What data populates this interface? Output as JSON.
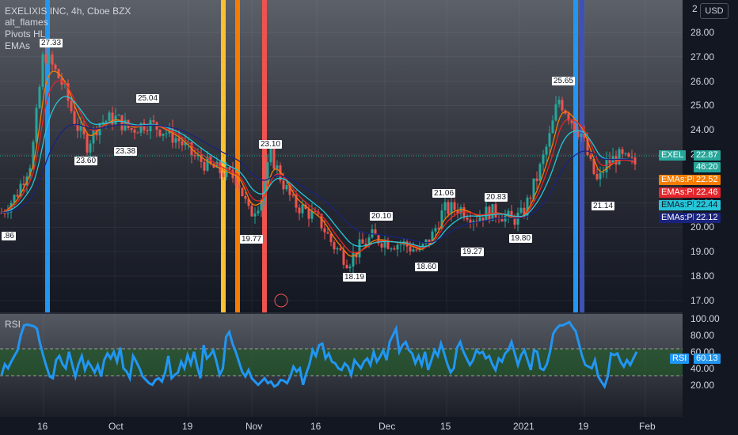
{
  "header": {
    "title": "EXELIXIS INC, 4h, Cboe BZX",
    "indicators": [
      "alt_flames",
      "Pivots HL",
      "EMAs"
    ],
    "currency_button": "USD"
  },
  "price_axis": [
    "28.00",
    "27.00",
    "26.00",
    "25.00",
    "24.00",
    "23.00",
    "22.00",
    "21.00",
    "20.00",
    "19.00",
    "18.00",
    "17.00"
  ],
  "price_axis_top_partial": "2",
  "price_tags": {
    "symbol": "EXEL",
    "last_price": "22.87",
    "countdown": "46:20",
    "ema_label": "EMAs:Plot",
    "ema_values": [
      "22.52",
      "22.46",
      "22.44",
      "22.12"
    ]
  },
  "colors": {
    "background": "#131722",
    "up": "#26a69a",
    "down": "#ef5350",
    "ema_orange": "#f57c00",
    "ema_red": "#e3262b",
    "ema_cyan": "#26c6da",
    "ema_navy": "#1a237e",
    "rsi_line": "#2196f3",
    "rsi_band": "#1b5e20"
  },
  "pivots": [
    {
      "label": "27.33",
      "hi": true
    },
    {
      "label": "25.04",
      "hi": true
    },
    {
      "label": "23.10",
      "hi": true
    },
    {
      "label": "23.60",
      "hi": false
    },
    {
      "label": "23.38",
      "hi": false
    },
    {
      "label": "19.77",
      "hi": false
    },
    {
      "label": "20.10",
      "hi": true
    },
    {
      "label": "21.06",
      "hi": true
    },
    {
      "label": "20.83",
      "hi": true
    },
    {
      "label": "25.65",
      "hi": true
    },
    {
      "label": "18.19",
      "hi": false
    },
    {
      "label": "18.60",
      "hi": false
    },
    {
      "label": "19.27",
      "hi": false
    },
    {
      "label": "19.80",
      "hi": false
    },
    {
      "label": "21.14",
      "hi": false
    },
    {
      "label": ".86",
      "hi": false
    }
  ],
  "rsi": {
    "title": "RSI",
    "axis": [
      "100.00",
      "80.00",
      "60.00",
      "40.00",
      "20.00"
    ],
    "label": "RSI",
    "value": "60.13",
    "values": [
      32,
      45,
      40,
      48,
      55,
      62,
      80,
      92,
      93,
      92,
      91,
      88,
      70,
      55,
      42,
      30,
      28,
      50,
      55,
      45,
      40,
      60,
      45,
      30,
      45,
      55,
      38,
      48,
      42,
      35,
      44,
      30,
      50,
      58,
      52,
      60,
      48,
      65,
      40,
      36,
      28,
      55,
      48,
      40,
      30,
      26,
      22,
      20,
      26,
      28,
      24,
      35,
      55,
      28,
      32,
      35,
      48,
      40,
      56,
      45,
      60,
      42,
      28,
      68,
      52,
      56,
      62,
      48,
      32,
      40,
      78,
      84,
      70,
      60,
      48,
      36,
      30,
      38,
      28,
      24,
      20,
      24,
      28,
      22,
      24,
      18,
      20,
      26,
      25,
      22,
      30,
      42,
      36,
      40,
      20,
      34,
      45,
      62,
      55,
      68,
      70,
      52,
      58,
      48,
      46,
      40,
      38,
      46,
      42,
      32,
      50,
      45,
      40,
      48,
      52,
      44,
      60,
      48,
      54,
      62,
      50,
      72,
      80,
      88,
      60,
      68,
      72,
      62,
      58,
      46,
      55,
      44,
      60,
      38,
      50,
      62,
      55,
      70,
      58,
      45,
      35,
      40,
      65,
      72,
      60,
      52,
      44,
      50,
      62,
      58,
      60,
      52,
      55,
      45,
      38,
      52,
      48,
      58,
      62,
      72,
      58,
      44,
      56,
      62,
      50,
      38,
      62,
      60,
      40,
      38,
      45,
      60,
      82,
      88,
      92,
      92,
      94,
      96,
      90,
      85,
      70,
      55,
      44,
      42,
      40,
      50,
      30,
      24,
      18,
      30,
      58,
      56,
      58,
      48,
      42,
      50,
      44,
      52,
      60
    ]
  },
  "time_axis": [
    "16",
    "Oct",
    "19",
    "Nov",
    "16",
    "Dec",
    "15",
    "2021",
    "19",
    "Feb"
  ]
}
